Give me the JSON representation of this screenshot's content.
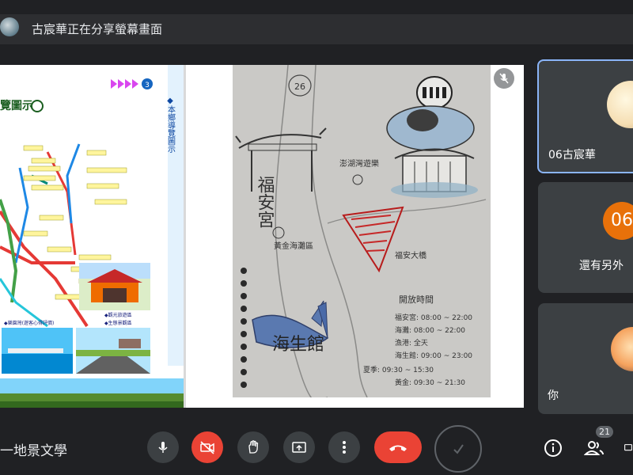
{
  "banner": {
    "text": "古宸華正在分享螢幕畫面"
  },
  "shared_screen": {
    "brochure": {
      "title_fragment": "覽圖示",
      "side_text": "◆本鄉導覽圖示",
      "page_number": "3",
      "captions": [
        "◆樂園灣(遊客心得評價)",
        "◆觀光旅遊區",
        "◆生態景觀區"
      ]
    },
    "drawing": {
      "page_number": "26",
      "temple_text": "福安宮",
      "spot1": "澎湖灣遊樂",
      "spot2": "黃金海灘區",
      "bridge_text": "福安大橋",
      "aquarium_text": "海生館",
      "hours_title": "開放時間",
      "hours": [
        "福安宮: 08:00 ~ 22:00",
        "海灘: 08:00 ~ 22:00",
        "漁港: 全天",
        "海生館: 09:00 ~ 23:00",
        "夏季: 09:30 ~ 15:30",
        "黃金: 09:30 ~ 21:30"
      ]
    }
  },
  "participants": [
    {
      "name": "06古宸華",
      "active_speaker": true
    },
    {
      "more_count": "06",
      "label": "還有另外"
    },
    {
      "name": "你"
    }
  ],
  "bottom_bar": {
    "meeting_title": "一地景文學",
    "participants_count": "21"
  },
  "colors": {
    "hangup_red": "#ea4335",
    "active_blue": "#8ab4f8",
    "more_orange": "#e8710a"
  }
}
